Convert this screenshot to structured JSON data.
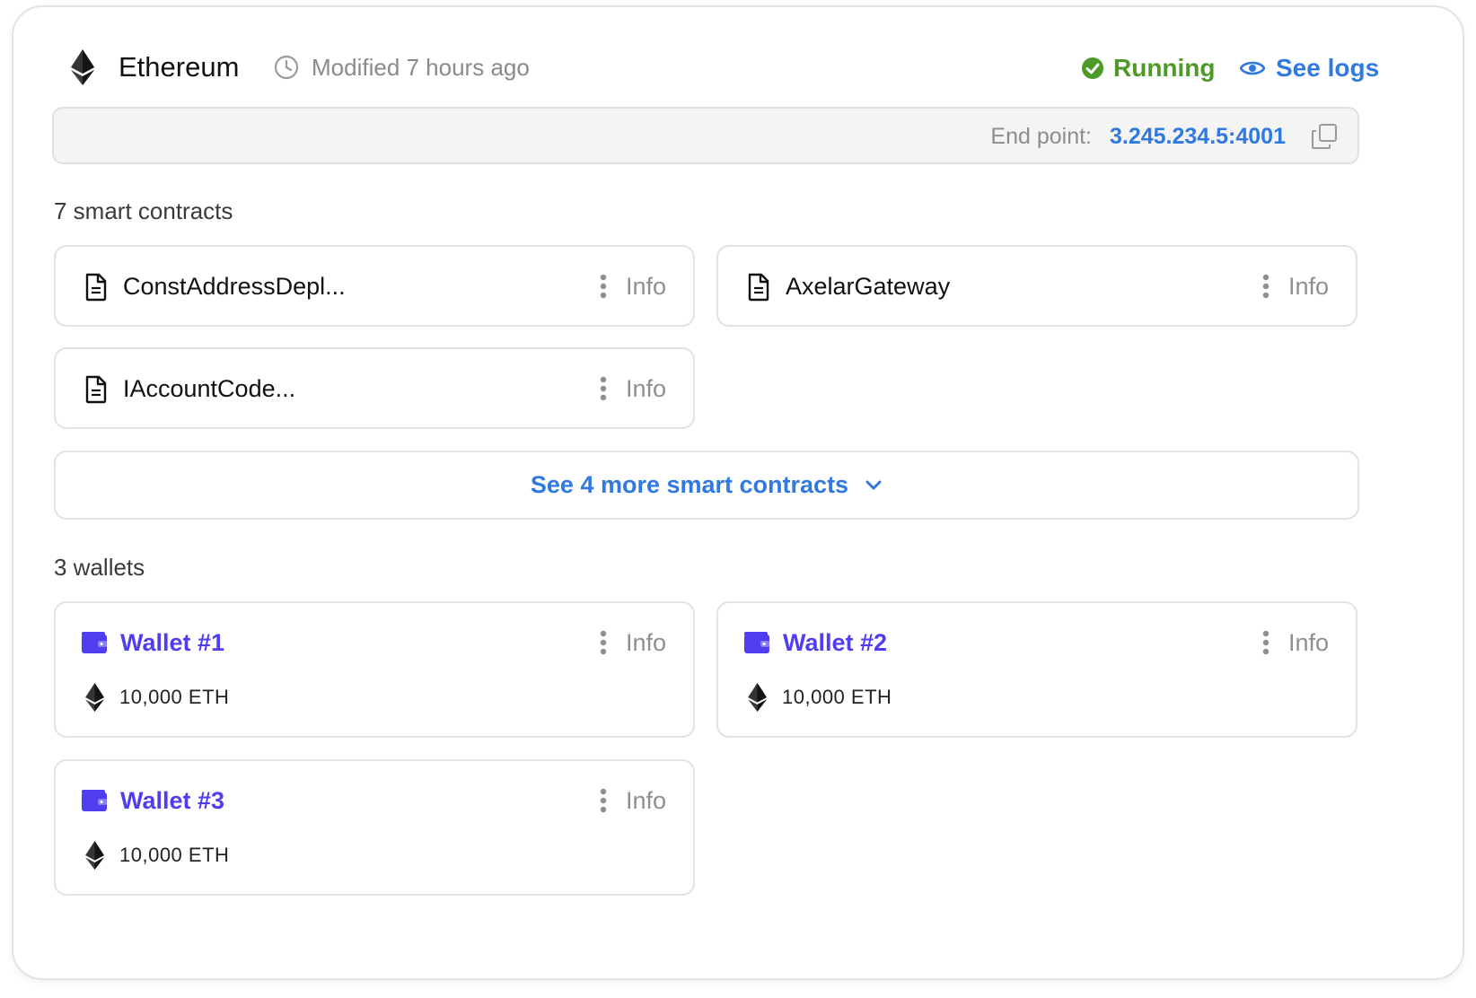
{
  "network": {
    "name": "Ethereum",
    "icon": "ethereum-icon",
    "modified": "Modified 7 hours ago",
    "status": "Running",
    "status_color": "#4e9a29",
    "logs_label": "See logs",
    "accent_color": "#2f79e0"
  },
  "endpoint": {
    "label": "End point:",
    "value": "3.245.234.5:4001"
  },
  "contracts": {
    "title": "7 smart contracts",
    "items": [
      {
        "name": "ConstAddressDepl...",
        "info": "Info"
      },
      {
        "name": "AxelarGateway",
        "info": "Info"
      },
      {
        "name": "IAccountCode...",
        "info": "Info"
      }
    ],
    "more_label": "See 4 more smart contracts"
  },
  "wallets": {
    "title": "3 wallets",
    "color": "#4f3df0",
    "items": [
      {
        "name": "Wallet #1",
        "info": "Info",
        "balance": "10,000 ETH"
      },
      {
        "name": "Wallet #2",
        "info": "Info",
        "balance": "10,000 ETH"
      },
      {
        "name": "Wallet #3",
        "info": "Info",
        "balance": "10,000 ETH"
      }
    ]
  }
}
